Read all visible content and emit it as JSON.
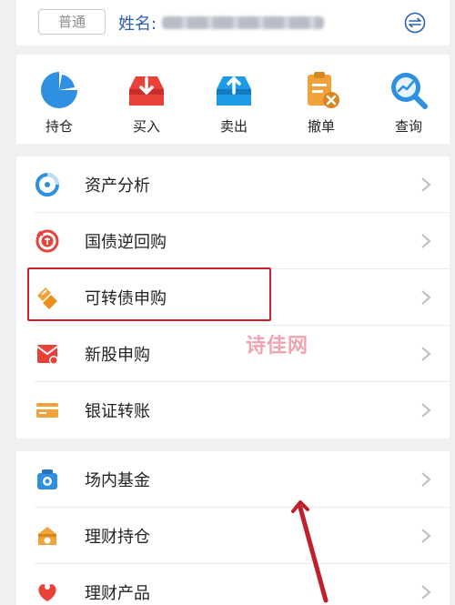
{
  "header": {
    "account_type": "普通",
    "name_label": "姓名:"
  },
  "quick_actions": [
    {
      "label": "持仓",
      "icon": "pie-chart-icon",
      "color": "#2f8fe0"
    },
    {
      "label": "买入",
      "icon": "tray-download-icon",
      "color": "#e8413a"
    },
    {
      "label": "卖出",
      "icon": "tray-upload-icon",
      "color": "#1e9be6"
    },
    {
      "label": "撤单",
      "icon": "clipboard-cancel-icon",
      "color": "#f2a23a"
    },
    {
      "label": "查询",
      "icon": "magnifier-chart-icon",
      "color": "#2f8fe0"
    }
  ],
  "group1": [
    {
      "label": "资产分析",
      "icon": "asset-analysis-icon"
    },
    {
      "label": "国债逆回购",
      "icon": "reverse-repo-icon"
    },
    {
      "label": "可转债申购",
      "icon": "convertible-bond-icon"
    },
    {
      "label": "新股申购",
      "icon": "ipo-subscription-icon"
    },
    {
      "label": "银证转账",
      "icon": "bank-card-icon"
    }
  ],
  "group2": [
    {
      "label": "场内基金",
      "icon": "fund-icon"
    },
    {
      "label": "理财持仓",
      "icon": "wealth-holding-icon"
    },
    {
      "label": "理财产品",
      "icon": "wealth-product-icon"
    }
  ],
  "watermark": "诗佳网",
  "colors": {
    "brand_blue": "#2d5fb0",
    "highlight_red": "#d21e2a"
  }
}
